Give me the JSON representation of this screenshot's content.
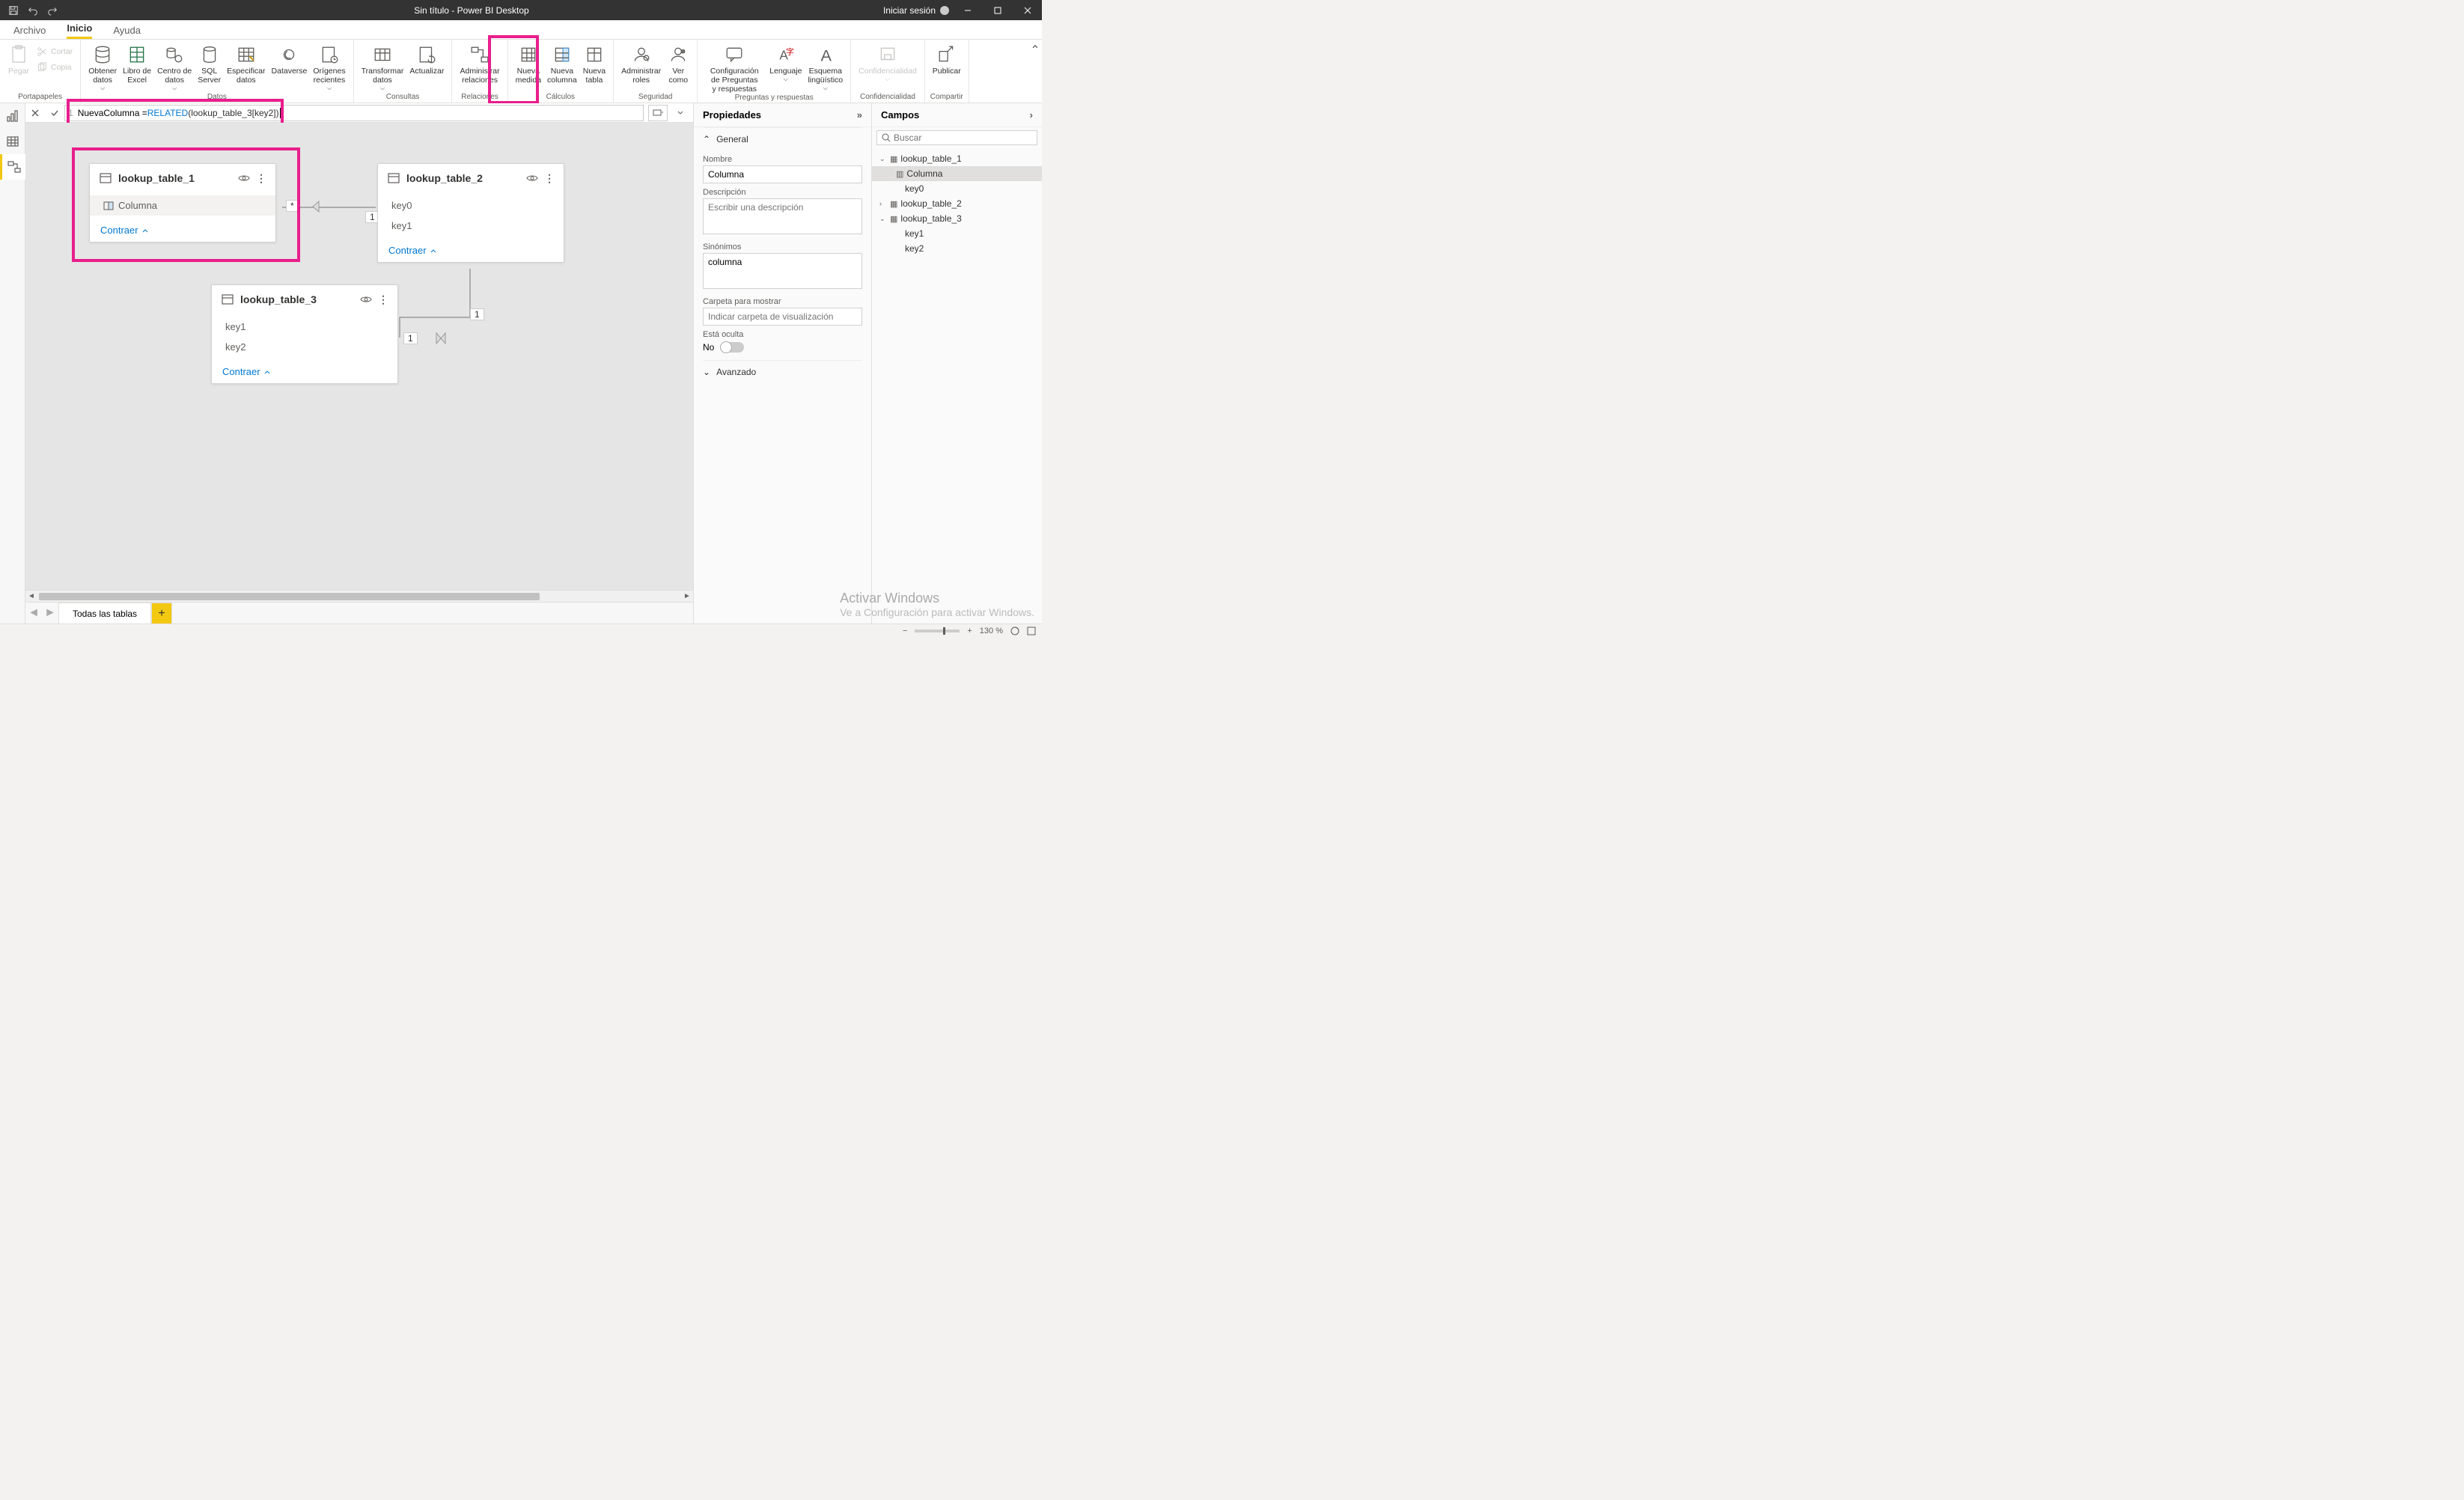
{
  "titlebar": {
    "title": "Sin título - Power BI Desktop",
    "signin": "Iniciar sesión"
  },
  "menutabs": [
    "Archivo",
    "Inicio",
    "Ayuda"
  ],
  "ribbon": {
    "clipboard": {
      "paste": "Pegar",
      "cut": "Cortar",
      "copy": "Copia",
      "group": "Portapapeles"
    },
    "data": {
      "get": "Obtener datos",
      "excel": "Libro de Excel",
      "hub": "Centro de datos",
      "sql": "SQL Server",
      "enter": "Especificar datos",
      "dataverse": "Dataverse",
      "recent": "Orígenes recientes",
      "group": "Datos"
    },
    "queries": {
      "transform": "Transformar datos",
      "refresh": "Actualizar",
      "group": "Consultas"
    },
    "relations": {
      "manage": "Administrar relaciones",
      "group": "Relaciones"
    },
    "calc": {
      "measure": "Nueva medida",
      "column": "Nueva columna",
      "table": "Nueva tabla",
      "group": "Cálculos"
    },
    "security": {
      "roles": "Administrar roles",
      "viewas": "Ver como",
      "group": "Seguridad"
    },
    "qa": {
      "setup": "Configuración de Preguntas y respuestas",
      "lang": "Lenguaje",
      "schema": "Esquema lingüístico",
      "group": "Preguntas y respuestas"
    },
    "conf": {
      "label": "Confidencialidad",
      "group": "Confidencialidad"
    },
    "share": {
      "publish": "Publicar",
      "group": "Compartir"
    }
  },
  "formula": {
    "linenr": "1",
    "prefix": "NuevaColumna = ",
    "func": "RELATED",
    "arg": "lookup_table_3[key2]"
  },
  "tables": {
    "t1": {
      "name": "lookup_table_1",
      "fields": [
        "Columna"
      ],
      "collapse": "Contraer"
    },
    "t2": {
      "name": "lookup_table_2",
      "fields": [
        "key0",
        "key1"
      ],
      "collapse": "Contraer"
    },
    "t3": {
      "name": "lookup_table_3",
      "fields": [
        "key1",
        "key2"
      ],
      "collapse": "Contraer"
    }
  },
  "rel": {
    "star": "*",
    "one_a": "1",
    "one_b": "1",
    "one_c": "1"
  },
  "sheets": {
    "tab": "Todas las tablas"
  },
  "props": {
    "title": "Propiedades",
    "general": "General",
    "name_label": "Nombre",
    "name_value": "Columna",
    "desc_label": "Descripción",
    "desc_placeholder": "Escribir una descripción",
    "syn_label": "Sinónimos",
    "syn_value": "columna",
    "folder_label": "Carpeta para mostrar",
    "folder_placeholder": "Indicar carpeta de visualización",
    "hidden_label": "Está oculta",
    "hidden_value": "No",
    "advanced": "Avanzado"
  },
  "fields": {
    "title": "Campos",
    "search": "Buscar",
    "tree": {
      "t1": "lookup_table_1",
      "t1_col": "Columna",
      "t1_key0": "key0",
      "t2": "lookup_table_2",
      "t3": "lookup_table_3",
      "t3_key1": "key1",
      "t3_key2": "key2"
    }
  },
  "watermark": {
    "line1": "Activar Windows",
    "line2": "Ve a Configuración para activar Windows."
  },
  "status": {
    "zoom": "130 %"
  }
}
